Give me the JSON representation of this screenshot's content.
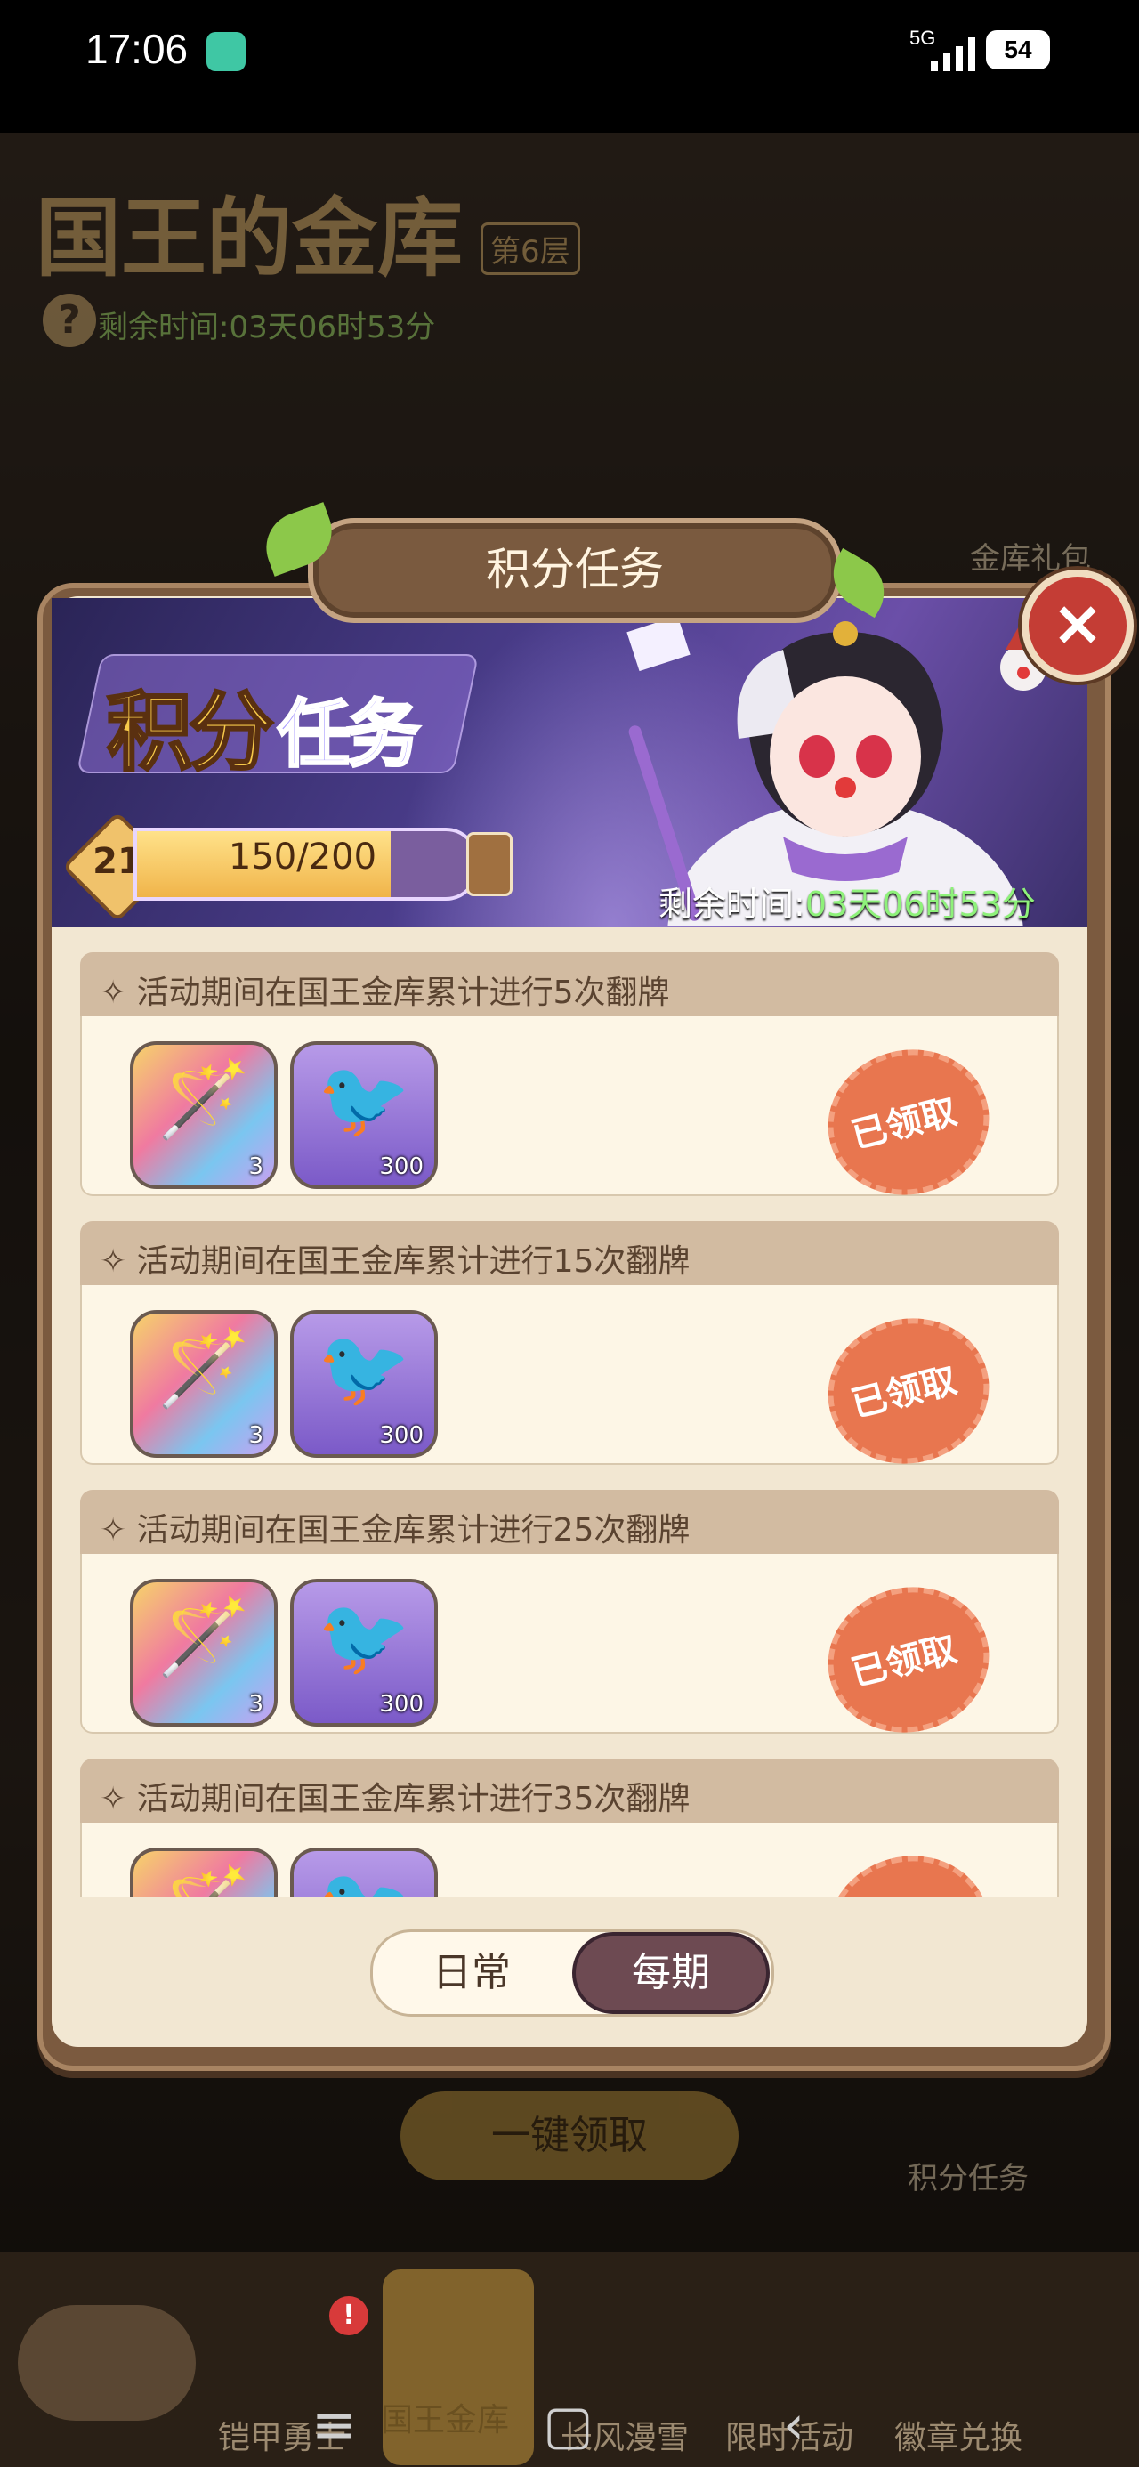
{
  "status_bar": {
    "time": "17:06",
    "network": "5G",
    "battery": "54"
  },
  "background": {
    "title": "国王的金库",
    "floor_badge": "第6层",
    "timer": "剩余时间:03天06时53分",
    "gift_label": "金库礼包",
    "claim_all": "一键领取",
    "tasks_label": "积分任务",
    "nav": [
      "铠甲勇士",
      "国王金库",
      "长风漫雪",
      "限时活动",
      "徽章兑换"
    ],
    "nav_badge": "!"
  },
  "modal": {
    "header_title": "积分任务",
    "close": "×",
    "banner": {
      "title_part1": "积分",
      "title_part2": "任务",
      "level": "21",
      "progress_text": "150/200",
      "progress_fraction": 0.75,
      "timer_label": "剩余时间:",
      "timer_value": "03天06时53分"
    },
    "tasks": [
      {
        "title": "活动期间在国王金库累计进行5次翻牌",
        "reward1_count": "3",
        "reward2_count": "300",
        "status": "已领取"
      },
      {
        "title": "活动期间在国王金库累计进行15次翻牌",
        "reward1_count": "3",
        "reward2_count": "300",
        "status": "已领取"
      },
      {
        "title": "活动期间在国王金库累计进行25次翻牌",
        "reward1_count": "3",
        "reward2_count": "300",
        "status": "已领取"
      },
      {
        "title": "活动期间在国王金库累计进行35次翻牌",
        "reward1_count": "",
        "reward2_count": "",
        "status": ""
      }
    ],
    "tabs": {
      "daily": "日常",
      "periodic": "每期",
      "active": "periodic"
    }
  },
  "colors": {
    "accent_brown": "#7a5a3f",
    "stamp_red": "#e8764f",
    "timer_green": "#8ef17a"
  },
  "icons": {
    "reward1": "magic-wand-icon",
    "reward2": "pink-bird-icon"
  }
}
